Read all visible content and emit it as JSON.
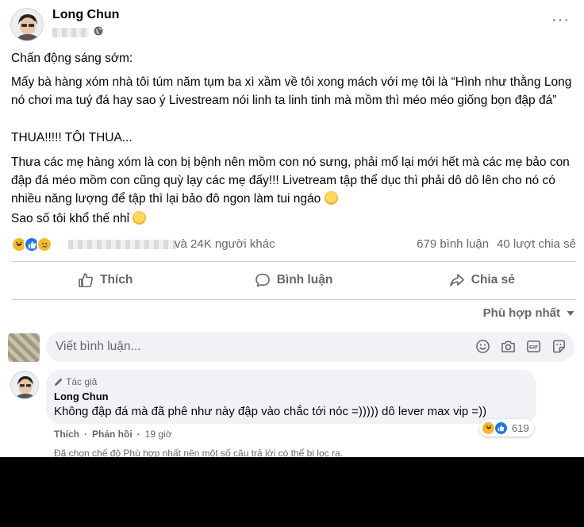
{
  "post": {
    "author": "Long Chun",
    "more_label": "···",
    "paragraphs": {
      "p1": "Chấn động sáng sớm:",
      "p2": "Mấy bà hàng xóm nhà tôi túm năm tụm ba xì xầm về tôi xong mách với mẹ tôi là “Hình như thằng Long nó chơi ma tuý đá hay sao ý Livestream nói linh ta linh tinh mà mồm thì méo méo giống bọn đập đá”",
      "p3": "THUA!!!!! TÔI THUA...",
      "p4": "Thưa các mẹ hàng xóm là con bị bệnh nên mồm con nó sưng, phải mổ lại mới hết mà các mẹ bảo con đập đá méo mồm con cũng quỳ lạy các mẹ đấy!!! Livetream tập thể dục thì phải dô dô lên cho nó có nhiều năng lượng để tập thì lại bảo đô ngon làm tui ngáo",
      "p5": "Sao số tôi khổ thế nhỉ"
    },
    "reactions_text": "và 24K người khác",
    "comments_count": "679 bình luận",
    "shares_count": "40 lượt chia sẻ",
    "reaction_icons": [
      "haha-icon",
      "like-icon",
      "sad-icon"
    ]
  },
  "actions": {
    "like": "Thích",
    "comment": "Bình luận",
    "share": "Chia sẻ"
  },
  "sort_label": "Phù hợp nhất",
  "comment_input": {
    "placeholder": "Viết bình luận..."
  },
  "comment": {
    "badge": "Tác giả",
    "author": "Long Chun",
    "text": "Không đập đá mà đã phê như này đập vào chắc tới nóc =))))) dô lever max vip =))",
    "reaction_count": "619",
    "like_label": "Thích",
    "reply_label": "Phản hồi",
    "time": "19 giờ",
    "separator": "·",
    "note": "Đã chọn chế độ Phù hợp nhất nên một số câu trả lời có thể bị lọc ra."
  },
  "colors": {
    "text": "#050505",
    "secondary": "#65676b",
    "like_blue": "#1877f2",
    "reaction_yellow": "#f7b928",
    "input_bg": "#f0f2f5"
  }
}
